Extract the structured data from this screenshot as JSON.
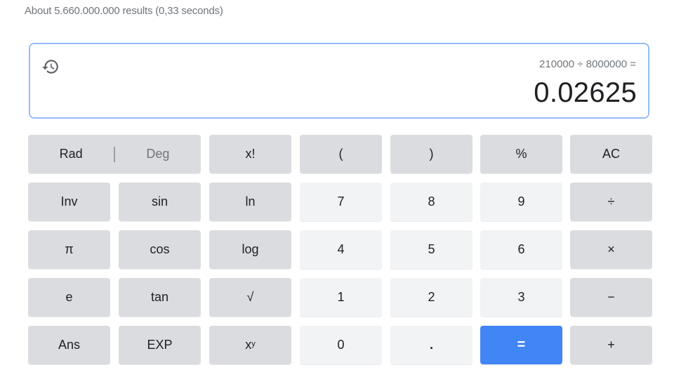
{
  "search": {
    "result_stats": "About 5.660.000.000 results (0,33 seconds)"
  },
  "calculator": {
    "display": {
      "history_icon": "history-icon",
      "expression": "210000 ÷ 8000000 =",
      "result": "0.02625"
    },
    "angle_mode": {
      "rad_label": "Rad",
      "deg_label": "Deg",
      "selected": "Rad"
    },
    "keys": {
      "factorial": "x!",
      "open_paren": "(",
      "close_paren": ")",
      "percent": "%",
      "clear": "AC",
      "inv": "Inv",
      "sin": "sin",
      "ln": "ln",
      "seven": "7",
      "eight": "8",
      "nine": "9",
      "divide": "÷",
      "pi": "π",
      "cos": "cos",
      "log": "log",
      "four": "4",
      "five": "5",
      "six": "6",
      "multiply": "×",
      "e": "e",
      "tan": "tan",
      "sqrt": "√",
      "one": "1",
      "two": "2",
      "three": "3",
      "minus": "−",
      "ans": "Ans",
      "exp": "EXP",
      "power_base": "x",
      "power_exp": "y",
      "zero": "0",
      "decimal": ".",
      "equals": "=",
      "plus": "+"
    },
    "colors": {
      "function_key": "#dadce0",
      "digit_key": "#f1f3f4",
      "equals_key": "#4285f4",
      "display_border": "#8ab4f8"
    }
  }
}
